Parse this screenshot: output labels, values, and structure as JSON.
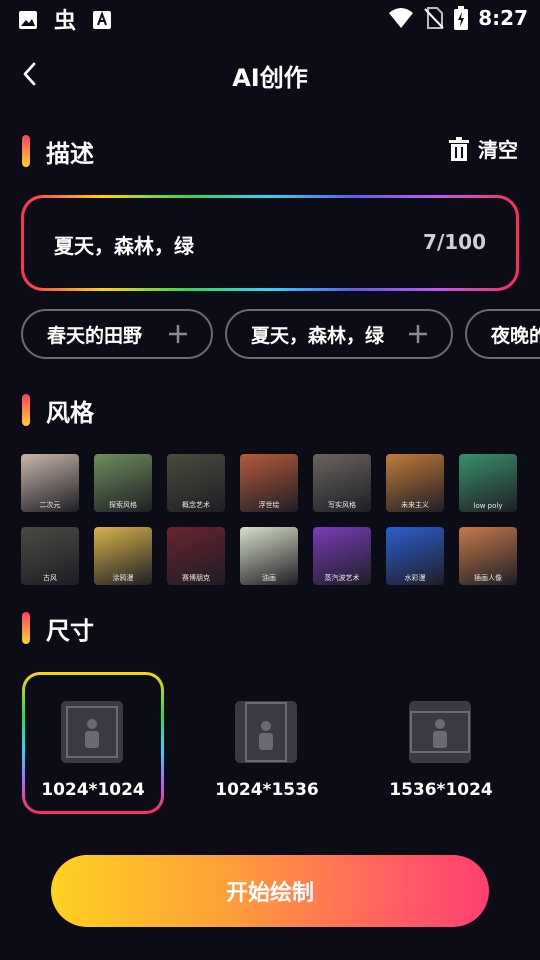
{
  "status_bar": {
    "time": "8:27",
    "icons_left": [
      "image-icon",
      "bug-icon",
      "text-icon"
    ],
    "icons_right": [
      "wifi-icon",
      "no-sim-icon",
      "battery-charging-icon"
    ]
  },
  "header": {
    "title": "AI创作",
    "back_icon": "back-arrow-icon"
  },
  "description": {
    "section_title": "描述",
    "clear_label": "清空",
    "clear_icon": "trash-icon",
    "text": "夏天，森林，绿",
    "count": "7/100",
    "suggestions": [
      "春天的田野",
      "夏天，森林，绿",
      "夜晚的"
    ]
  },
  "style": {
    "section_title": "风格",
    "row1": [
      {
        "label": "二次元",
        "color": "#c9b6a9"
      },
      {
        "label": "探索风格",
        "color": "#6e8f5c"
      },
      {
        "label": "概念艺术",
        "color": "#4b4a3e"
      },
      {
        "label": "浮世绘",
        "color": "#b55a3a"
      },
      {
        "label": "写实风格",
        "color": "#6a6460"
      },
      {
        "label": "未来主义",
        "color": "#c17a3a"
      },
      {
        "label": "low poly",
        "color": "#3b8f6c"
      }
    ],
    "row2": [
      {
        "label": "古风",
        "color": "#4a4a44"
      },
      {
        "label": "涂鸦漫",
        "color": "#d9b24a"
      },
      {
        "label": "赛博朋克",
        "color": "#6a2230"
      },
      {
        "label": "油画",
        "color": "#d8e0c8"
      },
      {
        "label": "蒸汽波艺术",
        "color": "#7a3cb8"
      },
      {
        "label": "水彩漫",
        "color": "#2b5fd0"
      },
      {
        "label": "插画人像",
        "color": "#c47a4a"
      }
    ]
  },
  "size": {
    "section_title": "尺寸",
    "options": [
      {
        "label": "1024*1024",
        "selected": true
      },
      {
        "label": "1024*1536",
        "selected": false
      },
      {
        "label": "1536*1024",
        "selected": false
      }
    ]
  },
  "action": {
    "start_label": "开始绘制"
  }
}
